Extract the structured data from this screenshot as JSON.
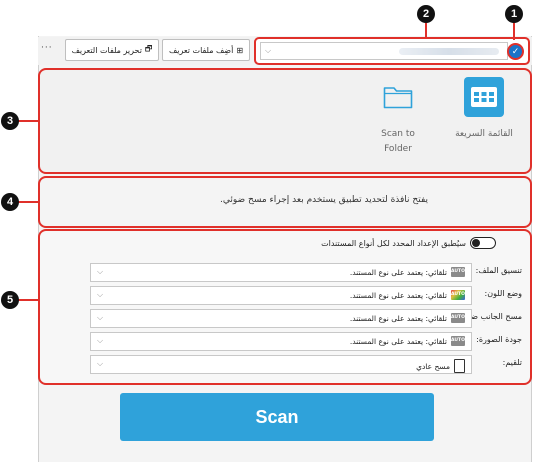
{
  "toolbar": {
    "more_label": "···",
    "edit_profiles_label": "تحرير ملفات التعريف",
    "add_profiles_label": "أضِف ملفات تعريف"
  },
  "scanner": {
    "selected_name_blurred": ""
  },
  "profiles": {
    "quick_menu_label": "القائمة السريعة",
    "scan_to_folder_label_line1": "Scan to",
    "scan_to_folder_label_line2": "Folder"
  },
  "info_text": "يفتح نافذة لتحديد تطبيق يستخدم بعد إجراء مسح ضوئي.",
  "settings": {
    "apply_toggle_label": "سيُطبق الإعداد المحدد لكل أنواع المستندات",
    "rows": [
      {
        "label": "تنسيق الملف:",
        "value": "تلقائي: يعتمد على نوع المستند.",
        "badge": "AUTO"
      },
      {
        "label": "وضع اللون:",
        "value": "تلقائي: يعتمد على نوع المستند.",
        "badge": "AUTO"
      },
      {
        "label": "مسح الجانب ضوئيًا:",
        "value": "تلقائي: يعتمد على نوع المستند.",
        "badge": "AUTO"
      },
      {
        "label": "جودة الصورة:",
        "value": "تلقائي: يعتمد على نوع المستند.",
        "badge": "AUTO"
      },
      {
        "label": "تلقيم:",
        "value": "مسح عادي",
        "badge": ""
      }
    ]
  },
  "scan_button_label": "Scan",
  "callouts": [
    "1",
    "2",
    "3",
    "4",
    "5"
  ],
  "colors": {
    "accent": "#2fa2da",
    "callout_border": "#e0302a",
    "check": "#1a73c8"
  }
}
